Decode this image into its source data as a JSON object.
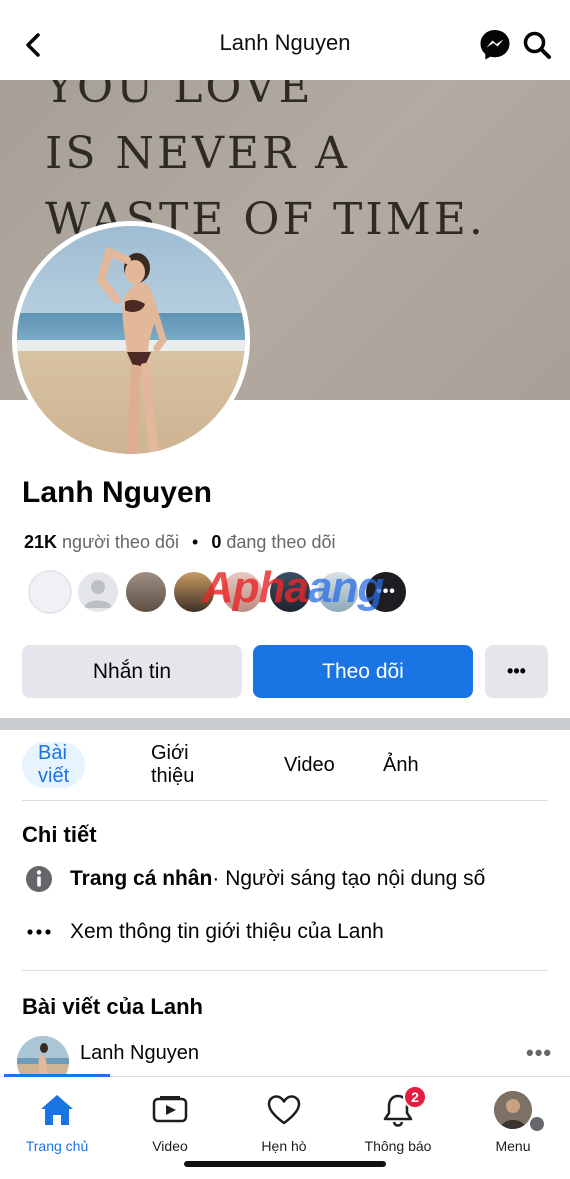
{
  "header": {
    "title": "Lanh Nguyen"
  },
  "cover": {
    "lines": [
      "YOU LOVE",
      "IS NEVER A",
      "WASTE OF TIME."
    ]
  },
  "profile": {
    "name": "Lanh Nguyen",
    "followers_count": "21K",
    "followers_label": "người theo dõi",
    "following_count": "0",
    "following_label": "đang theo dõi",
    "more_followers": "•••"
  },
  "watermark": {
    "part1": "Apha",
    "part2": "ang"
  },
  "actions": {
    "message": "Nhắn tin",
    "follow": "Theo dõi",
    "more": "•••"
  },
  "tabs": [
    {
      "label": "Bài viết",
      "active": true
    },
    {
      "label": "Giới thiệu",
      "active": false
    },
    {
      "label": "Video",
      "active": false
    },
    {
      "label": "Ảnh",
      "active": false
    }
  ],
  "details": {
    "title": "Chi tiết",
    "page_type_bold": "Trang cá nhân",
    "page_type_rest": " · Người sáng tạo nội dung số",
    "see_about": "Xem thông tin giới thiệu của Lanh"
  },
  "posts": {
    "title": "Bài viết của Lanh",
    "author": "Lanh Nguyen",
    "more": "•••"
  },
  "bottom_nav": [
    {
      "label": "Trang chủ",
      "icon": "home-icon",
      "active": true
    },
    {
      "label": "Video",
      "icon": "video-icon",
      "active": false
    },
    {
      "label": "Hẹn hò",
      "icon": "heart-icon",
      "active": false
    },
    {
      "label": "Thông báo",
      "icon": "bell-icon",
      "active": false,
      "badge": "2"
    },
    {
      "label": "Menu",
      "icon": "avatar",
      "active": false
    }
  ],
  "colors": {
    "accent": "#1b74e4",
    "badge": "#e41e3f",
    "tab_active_bg": "#e7f3ff"
  }
}
